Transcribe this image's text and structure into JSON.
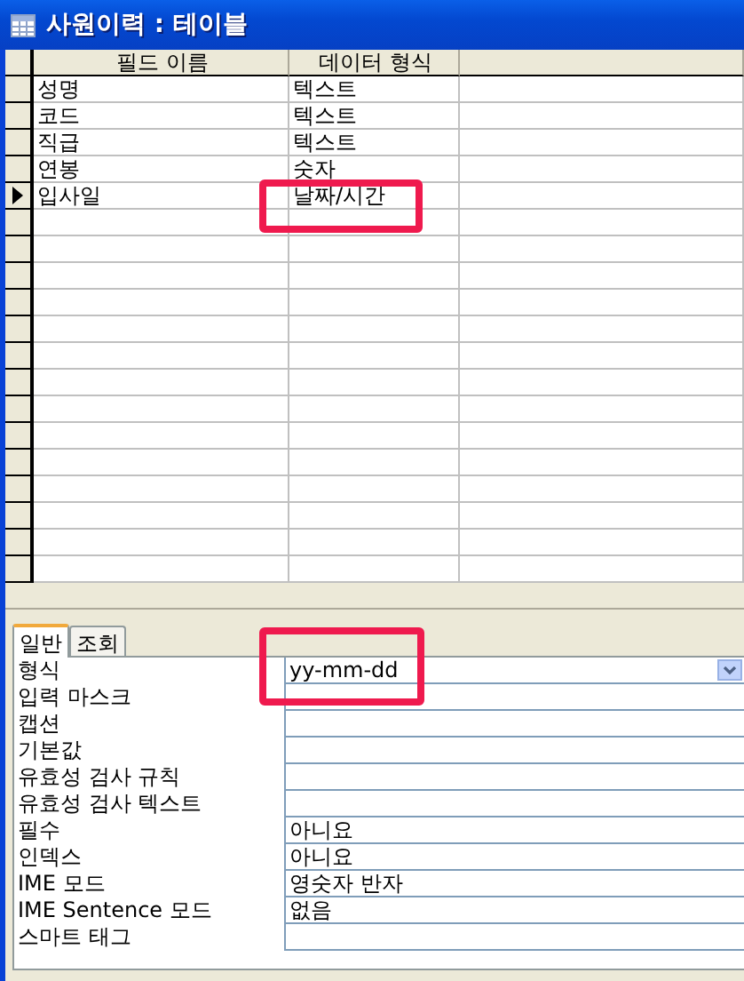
{
  "window": {
    "title": "사원이력 : 테이블"
  },
  "grid": {
    "columns": [
      "필드 이름",
      "데이터 형식"
    ],
    "rows": [
      {
        "field": "성명",
        "type": "텍스트",
        "current": false,
        "highlighted": false
      },
      {
        "field": "코드",
        "type": "텍스트",
        "current": false,
        "highlighted": false
      },
      {
        "field": "직급",
        "type": "텍스트",
        "current": false,
        "highlighted": false
      },
      {
        "field": "연봉",
        "type": "숫자",
        "current": false,
        "highlighted": false
      },
      {
        "field": "입사일",
        "type": "날짜/시간",
        "current": true,
        "highlighted": true
      }
    ]
  },
  "tabs": [
    {
      "label": "일반",
      "selected": true
    },
    {
      "label": "조회",
      "selected": false
    }
  ],
  "properties": [
    {
      "label": "형식",
      "value": "yy-mm-dd",
      "kind": "dropdown",
      "highlighted": true
    },
    {
      "label": "입력 마스크",
      "kind": "text",
      "highlighted": false
    },
    {
      "label": "캡션",
      "kind": "text",
      "highlighted": false
    },
    {
      "label": "기본값",
      "kind": "text",
      "highlighted": false
    },
    {
      "label": "유효성 검사 규칙",
      "kind": "text",
      "highlighted": false
    },
    {
      "label": "유효성 검사 텍스트",
      "kind": "text",
      "highlighted": false
    },
    {
      "label": "필수",
      "value": "아니요",
      "kind": "text",
      "highlighted": false
    },
    {
      "label": "인덱스",
      "value": "아니요",
      "kind": "text",
      "highlighted": false
    },
    {
      "label": "IME 모드",
      "value": "영숫자 반자",
      "kind": "text",
      "highlighted": false
    },
    {
      "label": "IME Sentence 모드",
      "value": "없음",
      "kind": "text",
      "highlighted": false
    },
    {
      "label": "스마트 태그",
      "kind": "text",
      "highlighted": false
    }
  ]
}
